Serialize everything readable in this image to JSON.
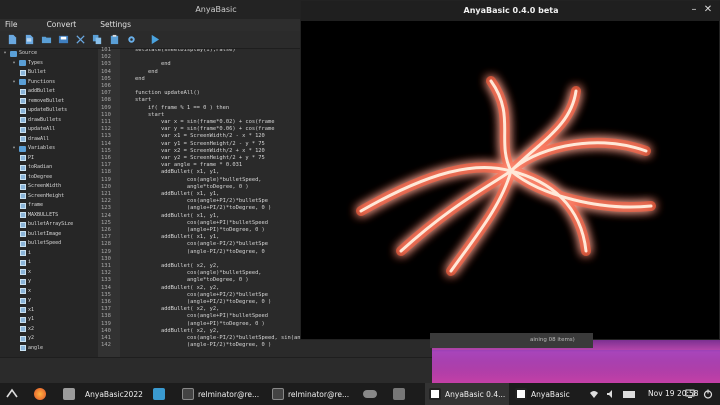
{
  "ide": {
    "title": "AnyaBasic",
    "menu": [
      "File",
      "Convert",
      "Settings"
    ],
    "toolbar": [
      "new-file-icon",
      "new-document-icon",
      "open-folder-icon",
      "save-icon",
      "cut-icon",
      "copy-icon",
      "paste-icon",
      "build-icon",
      "run-icon"
    ],
    "tree": [
      {
        "label": "Source",
        "level": 0,
        "kind": "folder",
        "expanded": true
      },
      {
        "label": "Types",
        "level": 1,
        "kind": "folder",
        "expanded": true
      },
      {
        "label": "Bullet",
        "level": 2,
        "kind": "item"
      },
      {
        "label": "Functions",
        "level": 1,
        "kind": "folder",
        "expanded": true
      },
      {
        "label": "addBullet",
        "level": 2,
        "kind": "item"
      },
      {
        "label": "removeBullet",
        "level": 2,
        "kind": "item"
      },
      {
        "label": "updateBullets",
        "level": 2,
        "kind": "item"
      },
      {
        "label": "drawBullets",
        "level": 2,
        "kind": "item"
      },
      {
        "label": "updateAll",
        "level": 2,
        "kind": "item"
      },
      {
        "label": "drawAll",
        "level": 2,
        "kind": "item"
      },
      {
        "label": "Variables",
        "level": 1,
        "kind": "folder",
        "expanded": true
      },
      {
        "label": "PI",
        "level": 2,
        "kind": "item"
      },
      {
        "label": "toRadian",
        "level": 2,
        "kind": "item"
      },
      {
        "label": "toDegree",
        "level": 2,
        "kind": "item"
      },
      {
        "label": "ScreenWidth",
        "level": 2,
        "kind": "item"
      },
      {
        "label": "ScreenHeight",
        "level": 2,
        "kind": "item"
      },
      {
        "label": "frame",
        "level": 2,
        "kind": "item"
      },
      {
        "label": "MAXBULLETS",
        "level": 2,
        "kind": "item"
      },
      {
        "label": "bulletArraySize",
        "level": 2,
        "kind": "item"
      },
      {
        "label": "bulletImage",
        "level": 2,
        "kind": "item"
      },
      {
        "label": "bulletSpeed",
        "level": 2,
        "kind": "item"
      },
      {
        "label": "i",
        "level": 2,
        "kind": "item"
      },
      {
        "label": "i",
        "level": 2,
        "kind": "item"
      },
      {
        "label": "x",
        "level": 2,
        "kind": "item"
      },
      {
        "label": "y",
        "level": 2,
        "kind": "item"
      },
      {
        "label": "x",
        "level": 2,
        "kind": "item"
      },
      {
        "label": "y",
        "level": 2,
        "kind": "item"
      },
      {
        "label": "x1",
        "level": 2,
        "kind": "item"
      },
      {
        "label": "y1",
        "level": 2,
        "kind": "item"
      },
      {
        "label": "x2",
        "level": 2,
        "kind": "item"
      },
      {
        "label": "y2",
        "level": 2,
        "kind": "item"
      },
      {
        "label": "angle",
        "level": 2,
        "kind": "item"
      }
    ],
    "code_lines": [
      {
        "n": "101",
        "t": "    setState(sheetDisplay(i),False)"
      },
      {
        "n": "102",
        "t": ""
      },
      {
        "n": "103",
        "t": "            end"
      },
      {
        "n": "104",
        "t": "        end"
      },
      {
        "n": "105",
        "t": "    end"
      },
      {
        "n": "106",
        "t": ""
      },
      {
        "n": "107",
        "t": "    function updateAll()"
      },
      {
        "n": "108",
        "t": "    start"
      },
      {
        "n": "109",
        "t": "        if( frame % 1 == 0 ) then"
      },
      {
        "n": "110",
        "t": "        start"
      },
      {
        "n": "111",
        "t": "            var x = sin(frame*0.02) + cos(frame"
      },
      {
        "n": "112",
        "t": "            var y = sin(frame*0.06) + cos(frame"
      },
      {
        "n": "113",
        "t": "            var x1 = ScreenWidth/2 - x * 120"
      },
      {
        "n": "114",
        "t": "            var y1 = ScreenHeight/2 - y * 75"
      },
      {
        "n": "115",
        "t": "            var x2 = ScreenWidth/2 + x * 120"
      },
      {
        "n": "116",
        "t": "            var y2 = ScreenHeight/2 + y * 75"
      },
      {
        "n": "117",
        "t": "            var angle = frame * 0.031"
      },
      {
        "n": "118",
        "t": "            addBullet( x1, y1,"
      },
      {
        "n": "119",
        "t": "                    cos(angle)*bulletSpeed,"
      },
      {
        "n": "120",
        "t": "                    angle*toDegree, 0 )"
      },
      {
        "n": "121",
        "t": "            addBullet( x1, y1,"
      },
      {
        "n": "122",
        "t": "                    cos(angle+PI/2)*bulletSpe"
      },
      {
        "n": "123",
        "t": "                    (angle+PI/2)*toDegree, 0 )"
      },
      {
        "n": "124",
        "t": "            addBullet( x1, y1,"
      },
      {
        "n": "125",
        "t": "                    cos(angle+PI)*bulletSpeed"
      },
      {
        "n": "126",
        "t": "                    (angle+PI)*toDegree, 0 )"
      },
      {
        "n": "127",
        "t": "            addBullet( x1, y1,"
      },
      {
        "n": "128",
        "t": "                    cos(angle-PI/2)*bulletSpe"
      },
      {
        "n": "129",
        "t": "                    (angle-PI/2)*toDegree, 0"
      },
      {
        "n": "130",
        "t": ""
      },
      {
        "n": "131",
        "t": "            addBullet( x2, y2,"
      },
      {
        "n": "132",
        "t": "                    cos(angle)*bulletSpeed,"
      },
      {
        "n": "133",
        "t": "                    angle*toDegree, 0 )"
      },
      {
        "n": "134",
        "t": "            addBullet( x2, y2,"
      },
      {
        "n": "135",
        "t": "                    cos(angle+PI/2)*bulletSpe"
      },
      {
        "n": "136",
        "t": "                    (angle+PI/2)*toDegree, 0 )"
      },
      {
        "n": "137",
        "t": "            addBullet( x2, y2,"
      },
      {
        "n": "138",
        "t": "                    cos(angle+PI)*bulletSpeed"
      },
      {
        "n": "139",
        "t": "                    (angle+PI)*toDegree, 0 )"
      },
      {
        "n": "140",
        "t": "            addBullet( x2, y2,"
      },
      {
        "n": "141",
        "t": "                    cos(angle-PI/2)*bulletSpeed, sin(angle-PI/2)*bulletSpeed,"
      },
      {
        "n": "142",
        "t": "                    (angle-PI/2)*toDegree, 0 )"
      }
    ]
  },
  "run_window": {
    "title": "AnyaBasic 0.4.0 beta",
    "minimize_glyph": "–",
    "close_glyph": "✕"
  },
  "notice_text": "aining 08 items)",
  "taskbar": {
    "items": [
      {
        "label": "",
        "icon": "app-menu-icon"
      },
      {
        "label": "",
        "icon": "firefox-icon"
      },
      {
        "label": "AnyaBasic2022",
        "icon": "folder-icon"
      },
      {
        "label": "",
        "icon": "app-icon"
      },
      {
        "label": "",
        "icon": "terminal-icon"
      },
      {
        "label": "relminator@re...",
        "icon": "terminal-icon"
      },
      {
        "label": "relminator@re...",
        "icon": "terminal-icon"
      },
      {
        "label": "",
        "icon": "toggle-icon"
      },
      {
        "label": "",
        "icon": "window-icon"
      },
      {
        "label": "AnyaBasic 0.4...",
        "icon": "anyabasic-icon"
      },
      {
        "label": "AnyaBasic",
        "icon": "anyabasic-icon"
      }
    ],
    "tray": [
      "wifi-icon",
      "volume-icon",
      "battery-icon"
    ],
    "clock": "Nov 19  20:58",
    "tray_after": [
      "network-icon",
      "power-icon"
    ]
  },
  "colors": {
    "accent": "#5a9fd6",
    "run_icon": "#4aa3df",
    "glow": "#ff6040"
  }
}
